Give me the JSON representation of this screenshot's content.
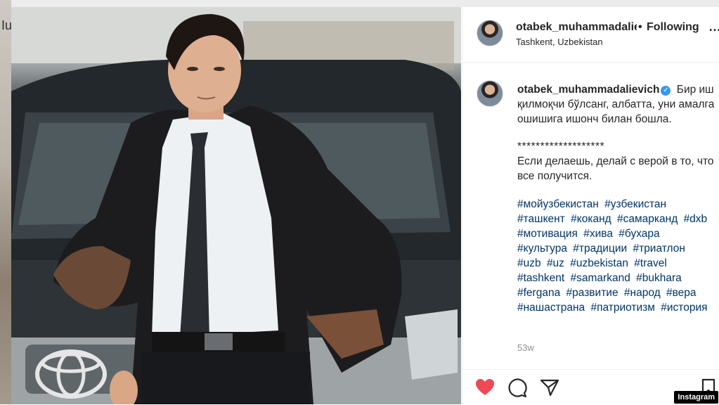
{
  "post": {
    "author": "otabek_muhammadaliev",
    "author_full": "otabek_muhammadalievich",
    "separator": "•",
    "follow_status": "Following",
    "location": "Tashkent, Uzbekistan",
    "more": "…",
    "caption_uz": "Бир иш қилмоқчи бўлсанг, албатта, уни амалга ошишига ишонч билан бошла.",
    "stars": "*******************",
    "caption_ru": "Если делаешь, делай с верой в то, что все получится.",
    "hashtags": [
      "#мойузбекистан",
      "#узбекистан",
      "#ташкент",
      "#коканд",
      "#самарканд",
      "#dxb",
      "#мотивация",
      "#хива",
      "#бухара",
      "#культура",
      "#традиции",
      "#триатлон",
      "#uzb",
      "#uz",
      "#uzbekistan",
      "#travel",
      "#tashkent",
      "#samarkand",
      "#bukhara",
      "#fergana",
      "#развитие",
      "#народ",
      "#вера",
      "#нашастрана",
      "#патриотизм",
      "#история"
    ],
    "timestamp": "53w",
    "verified_mark": "✓",
    "liked": true
  },
  "watermark": "Instagram",
  "left_strip_text": "Iu",
  "colors": {
    "heart": "#ed4956",
    "hashtag": "#003569",
    "verified": "#3897f0",
    "muted": "#8e8e8e"
  },
  "icons": [
    "heart-icon",
    "comment-icon",
    "share-icon",
    "bookmark-icon",
    "verified-badge-icon",
    "more-icon"
  ]
}
